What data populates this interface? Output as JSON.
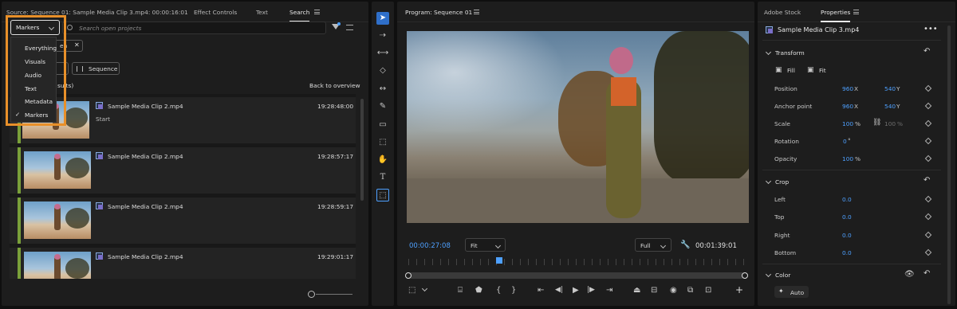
{
  "colors": {
    "accent": "#4ea0ff",
    "highlight_orange": "#e8902a",
    "marker_green": "#7aa03a",
    "panel": "#1d1d1d"
  },
  "source_panel": {
    "tabs": [
      "Source: Sequence 01: Sample Media Clip 3.mp4: 00:00:16:01",
      "Effect Controls",
      "Text",
      "Search"
    ],
    "active_tab": "Search",
    "filter_select": "Markers",
    "search_placeholder": "Search open projects",
    "chip_label": "en",
    "sequence_button": "Sequence",
    "results_count": "sults)",
    "back_link": "Back to overview",
    "dropdown": {
      "items": [
        "Everything",
        "Visuals",
        "Audio",
        "Text",
        "Metadata",
        "Markers"
      ],
      "checked": "Markers"
    },
    "results": [
      {
        "name": "Sample Media Clip 2.mp4",
        "sub": "Start",
        "time": "19:28:48:00"
      },
      {
        "name": "Sample Media Clip 2.mp4",
        "sub": "",
        "time": "19:28:57:17"
      },
      {
        "name": "Sample Media Clip 2.mp4",
        "sub": "",
        "time": "19:28:59:17"
      },
      {
        "name": "Sample Media Clip 2.mp4",
        "sub": "",
        "time": "19:29:01:17"
      }
    ],
    "zoom_icon": "zoom-slider"
  },
  "tools": [
    "selection-icon",
    "track-select-icon",
    "ripple-edit-icon",
    "razor-icon",
    "slip-icon",
    "pen-icon",
    "rectangle-icon",
    "transform-icon",
    "hand-icon",
    "type-icon",
    "caption-icon"
  ],
  "program": {
    "title": "Program: Sequence 01",
    "timecode": "00:00:27:08",
    "fit_select": "Fit",
    "quality_select": "Full",
    "duration": "00:01:39:01",
    "playhead_fraction": 0.27
  },
  "properties": {
    "tabs": [
      "Adobe Stock",
      "Properties"
    ],
    "active_tab": "Properties",
    "clip_name": "Sample Media Clip 3.mp4",
    "transform": {
      "title": "Transform",
      "fill_label": "Fill",
      "fit_label": "Fit",
      "position_label": "Position",
      "position_x": "960",
      "position_y": "540",
      "anchor_label": "Anchor point",
      "anchor_x": "960",
      "anchor_y": "540",
      "scale_label": "Scale",
      "scale": "100",
      "scale2": "100",
      "rotation_label": "Rotation",
      "rotation": "0",
      "opacity_label": "Opacity",
      "opacity": "100",
      "x": "X",
      "y": "Y",
      "pct": "%",
      "deg": "°"
    },
    "crop": {
      "title": "Crop",
      "left_label": "Left",
      "left": "0.0",
      "top_label": "Top",
      "top": "0.0",
      "right_label": "Right",
      "right": "0.0",
      "bottom_label": "Bottom",
      "bottom": "0.0"
    },
    "color": {
      "title": "Color",
      "auto_label": "Auto"
    }
  }
}
